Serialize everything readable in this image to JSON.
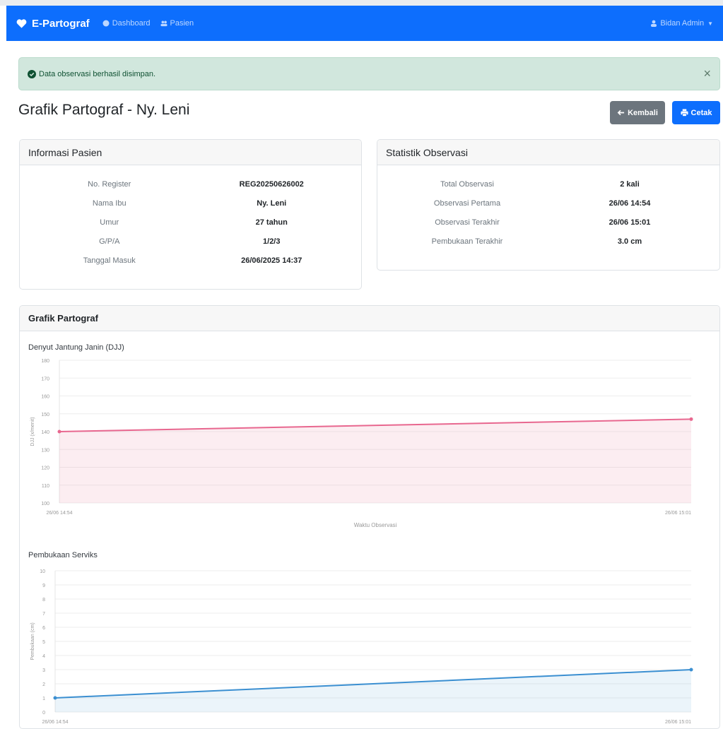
{
  "navbar": {
    "brand": "E-Partograf",
    "links": [
      "Dashboard",
      "Pasien"
    ],
    "user": "Bidan Admin"
  },
  "alert": {
    "message": "Data observasi berhasil disimpan.",
    "close": "×"
  },
  "page": {
    "title": "Grafik Partograf - Ny. Leni",
    "back_label": "Kembali",
    "print_label": "Cetak"
  },
  "patient": {
    "header": "Informasi Pasien",
    "rows": [
      {
        "label": "No. Register",
        "value": "REG20250626002"
      },
      {
        "label": "Nama Ibu",
        "value": "Ny. Leni"
      },
      {
        "label": "Umur",
        "value": "27 tahun"
      },
      {
        "label": "G/P/A",
        "value": "1/2/3"
      },
      {
        "label": "Tanggal Masuk",
        "value": "26/06/2025 14:37"
      }
    ]
  },
  "stats": {
    "header": "Statistik Observasi",
    "rows": [
      {
        "label": "Total Observasi",
        "value": "2 kali"
      },
      {
        "label": "Observasi Pertama",
        "value": "26/06 14:54"
      },
      {
        "label": "Observasi Terakhir",
        "value": "26/06 15:01"
      },
      {
        "label": "Pembukaan Terakhir",
        "value": "3.0 cm"
      }
    ]
  },
  "graph_card": {
    "header": "Grafik Partograf"
  },
  "colors": {
    "primary": "#0d6efd",
    "djj_line": "#e8678f",
    "cervix_line": "#3b8fd1"
  },
  "chart_data": [
    {
      "type": "area",
      "title": "Denyut Jantung Janin (DJJ)",
      "xlabel": "Waktu Observasi",
      "ylabel": "DJJ (x/menit)",
      "x": [
        "26/06 14:54",
        "26/06 15:01"
      ],
      "series": [
        {
          "values": [
            140,
            147
          ]
        }
      ],
      "ylim": [
        100,
        180
      ],
      "yticks": [
        100,
        110,
        120,
        130,
        140,
        150,
        160,
        170,
        180
      ],
      "grid": true
    },
    {
      "type": "area",
      "title": "Pembukaan Serviks",
      "xlabel": "",
      "ylabel": "Pembukaan (cm)",
      "x": [
        "26/06 14:54",
        "26/06 15:01"
      ],
      "series": [
        {
          "values": [
            1,
            3
          ]
        }
      ],
      "ylim": [
        0,
        10
      ],
      "yticks": [
        0,
        1,
        2,
        3,
        4,
        5,
        6,
        7,
        8,
        9,
        10
      ],
      "grid": true
    }
  ]
}
